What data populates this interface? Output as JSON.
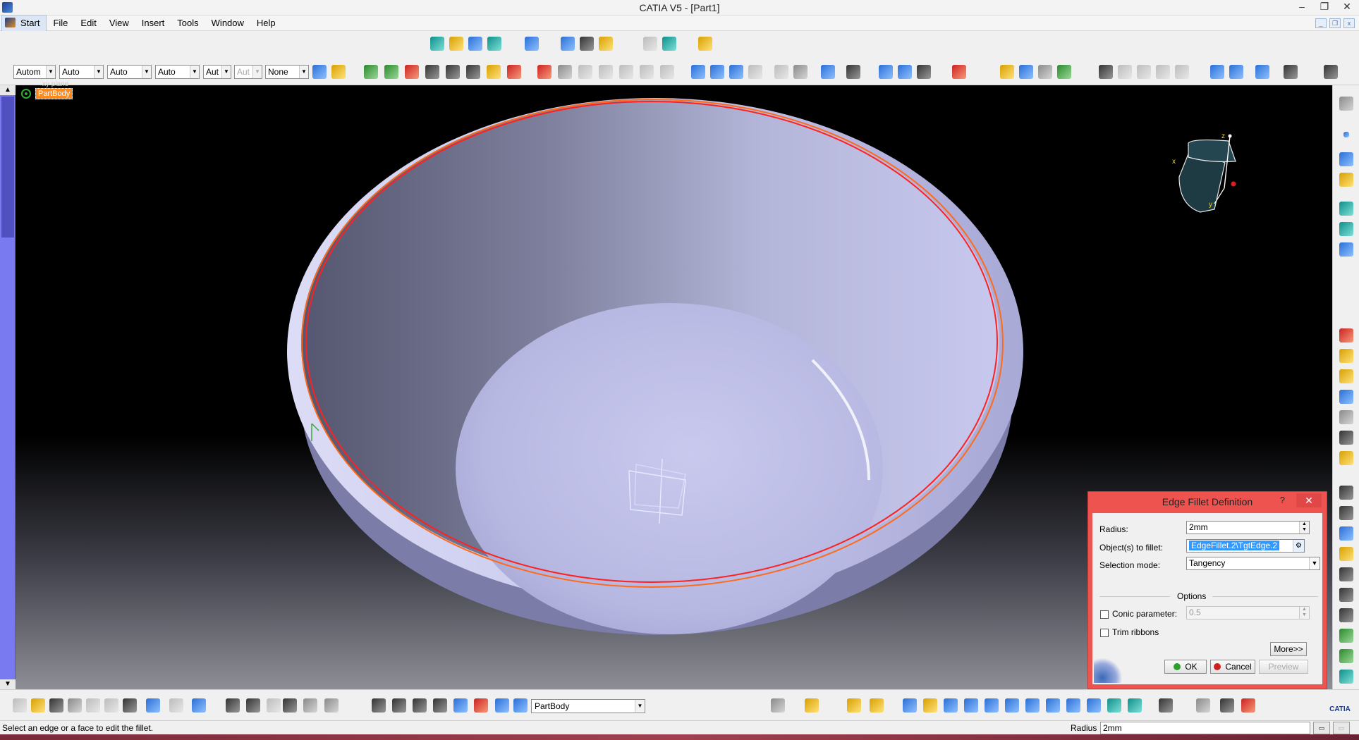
{
  "window": {
    "title": "CATIA V5 - [Part1]",
    "controls": [
      "–",
      "❐",
      "✕"
    ]
  },
  "menu": {
    "items": [
      "Start",
      "File",
      "Edit",
      "View",
      "Insert",
      "Tools",
      "Window",
      "Help"
    ]
  },
  "toolbar": {
    "combos": [
      "Autom",
      "Auto",
      "Auto",
      "Auto",
      "Aut",
      "Aut",
      "None"
    ]
  },
  "tree": {
    "above_label": "xy plane",
    "partbody_label": "PartBody"
  },
  "compass": {
    "x_label": "x",
    "y_label": "y",
    "z_label": "z"
  },
  "dialog": {
    "title": "Edge Fillet Definition",
    "help": "?",
    "close": "✕",
    "radius_label": "Radius:",
    "radius_value": "2mm",
    "objects_label": "Object(s) to fillet:",
    "objects_value": "EdgeFillet.2\\TgtEdge.2",
    "selection_mode_label": "Selection mode:",
    "selection_mode_value": "Tangency",
    "options_label": "Options",
    "conic_label": "Conic parameter:",
    "conic_value": "0.5",
    "conic_checked": false,
    "trim_label": "Trim ribbons",
    "trim_checked": false,
    "more_button": "More>>",
    "ok_button": "OK",
    "cancel_button": "Cancel",
    "preview_button": "Preview"
  },
  "bottom": {
    "body_combo": "PartBody"
  },
  "status": {
    "message": "Select an edge or a face to edit the fillet.",
    "radius_label": "Radius",
    "radius_value": "2mm"
  },
  "colors": {
    "viewport_bg": "#000000",
    "part_surface": "#b4b4e6",
    "fillet_edge": "#ff3b1f",
    "dialog_frame": "#ef5350",
    "tree_highlight": "#ff8a1c"
  }
}
